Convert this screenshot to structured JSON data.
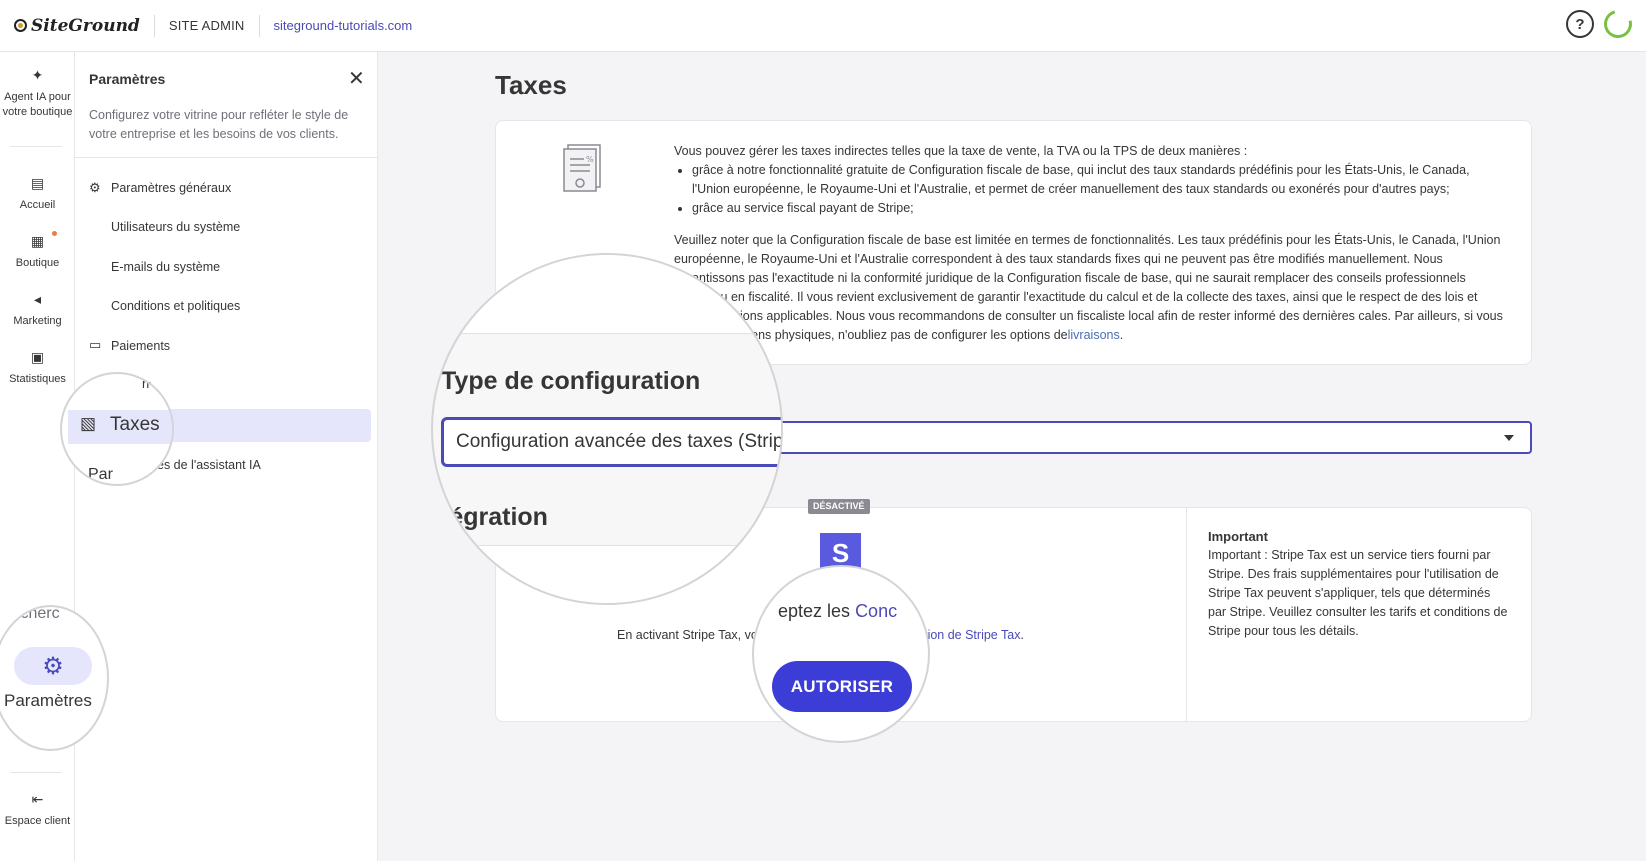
{
  "topbar": {
    "brand": "SiteGround",
    "section": "SITE ADMIN",
    "domain": "siteground-tutorials.com",
    "help_icon": "question-icon",
    "status_icon": "loader-icon"
  },
  "rail": {
    "ai_agent": "Agent IA pour votre boutique",
    "home": "Accueil",
    "shop": "Boutique",
    "marketing": "Marketing",
    "stats": "Statistiques",
    "search_fragment": "Recherc",
    "settings": "Paramètres",
    "client_area": "Espace client"
  },
  "panel": {
    "title": "Paramètres",
    "description": "Configurez votre vitrine pour refléter le style de votre entreprise et les besoins de vos clients.",
    "items": [
      {
        "label": "Paramètres généraux"
      },
      {
        "label": "Utilisateurs du système"
      },
      {
        "label": "E-mails du système"
      },
      {
        "label": "Conditions et politiques"
      },
      {
        "label": "Paiements"
      },
      {
        "label": "n"
      },
      {
        "label": "Taxes"
      },
      {
        "label": "es de l'assistant IA"
      }
    ],
    "fragment_par": "Par"
  },
  "main": {
    "title": "Taxes",
    "intro": "Vous pouvez gérer les taxes indirectes telles que la taxe de vente, la TVA ou la TPS de deux manières :",
    "bullets": [
      "grâce à notre fonctionnalité gratuite de Configuration fiscale de base, qui inclut des taux standards prédéfinis pour les États-Unis, le Canada, l'Union européenne, le Royaume-Uni et l'Australie, et permet de créer manuellement des taux standards ou exonérés pour d'autres pays;",
      "grâce au service fiscal payant de Stripe;"
    ],
    "note": "Veuillez noter que la Configuration fiscale de base est limitée en termes de fonctionnalités. Les taux prédéfinis pour les États-Unis, le Canada, l'Union européenne, le Royaume-Uni et l'Australie correspondent à des taux standards fixes qui ne peuvent pas être modifiés manuellement. Nous garantissons pas l'exactitude ni la conformité juridique de la Configuration fiscale de base, qui ne saurait remplacer des conseils professionnels tabilité ou en fiscalité. Il vous revient exclusivement de garantir l'exactitude du calcul et de la collecte des taxes, ainsi que le respect de des lois et réglementations applicables. Nous vous recommandons de consulter un fiscaliste local afin de rester informé des dernières cales. Par ailleurs, si vous vendez des biens physiques, n'oubliez pas de configurer les options de",
    "note_link": "livraisons",
    "config_heading": "Type de configuration",
    "config_value": "Configuration avancée des taxes (Strip",
    "integration_heading": "tégration",
    "badge": "DÉSACTIVÉ",
    "stripe_letter": "S",
    "consent_fragment": "eptez les",
    "consent_link_fragment": "Conc",
    "consent_line": "En activant Stripe Tax, vo",
    "consent_line_link": "d'utilisation de Stripe Tax",
    "authorize_button": "AUTORISER",
    "important_title": "Important",
    "important_text": "Important : Stripe Tax est un service tiers fourni par Stripe. Des frais supplémentaires pour l'utilisation de Stripe Tax peuvent s'appliquer, tels que déterminés par Stripe. Veuillez consulter les tarifs et conditions de Stripe pour tous les détails."
  },
  "colors": {
    "accent": "#4a4ab8",
    "button": "#3c3cd6",
    "active_bg": "#e5e6fb",
    "badge_bg": "#8a8a92",
    "brand_green": "#79c142"
  }
}
